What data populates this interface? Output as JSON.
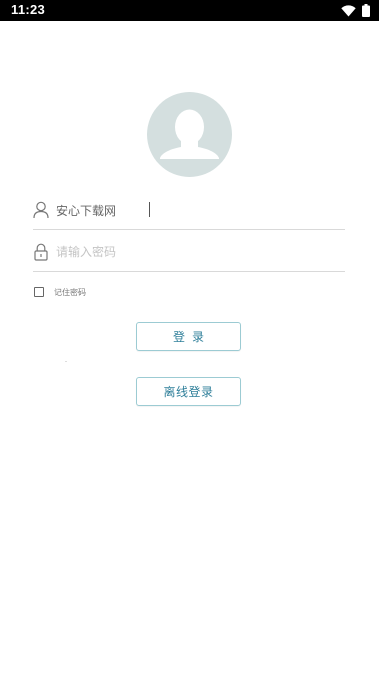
{
  "status_bar": {
    "time": "11:23",
    "icons": [
      "wifi-icon",
      "battery-icon"
    ]
  },
  "avatar": {
    "icon": "default-user-avatar-icon",
    "background_color": "#d4dfdf"
  },
  "form": {
    "username": {
      "icon": "user-icon",
      "value": "安心下载网"
    },
    "password": {
      "icon": "lock-icon",
      "placeholder": "请输入密码",
      "value": ""
    },
    "remember": {
      "label": "记住密码",
      "checked": false
    }
  },
  "buttons": {
    "login_label": "登录",
    "offline_login_label": "离线登录"
  },
  "colors": {
    "accent": "#2f7f9a",
    "button_border": "#9ccbd3",
    "divider": "#d9d9d9"
  }
}
